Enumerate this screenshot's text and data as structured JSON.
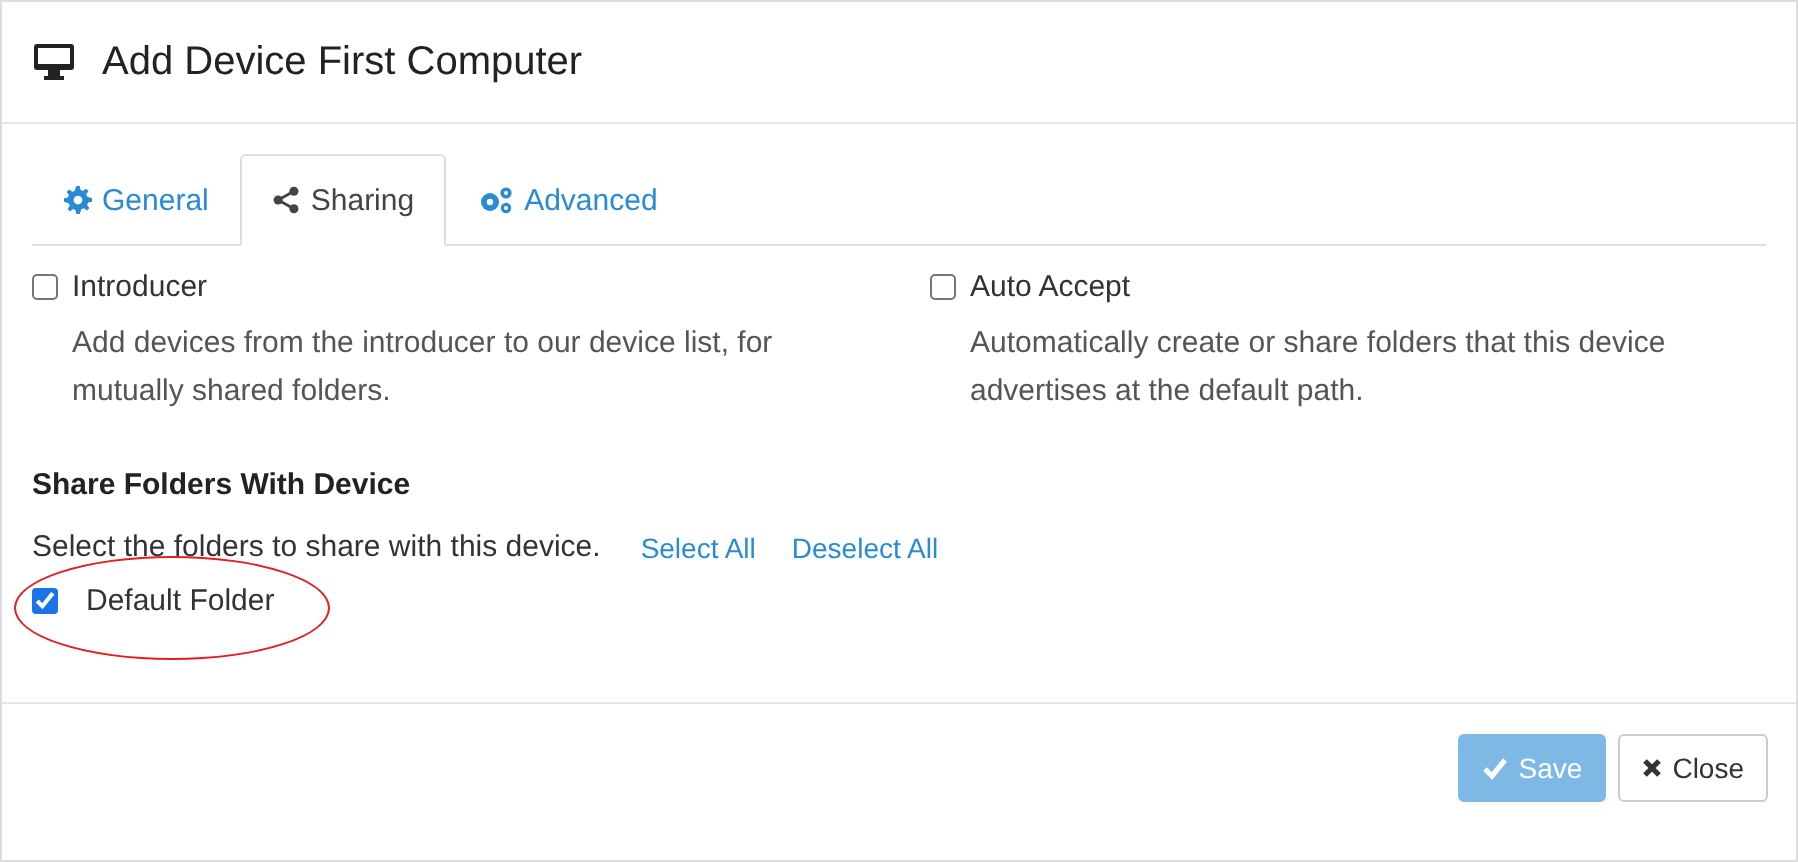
{
  "window": {
    "title": "Add Device First Computer"
  },
  "tabs": [
    {
      "label": "General",
      "selected": false
    },
    {
      "label": "Sharing",
      "selected": true
    },
    {
      "label": "Advanced",
      "selected": false
    }
  ],
  "options": [
    {
      "label": "Introducer",
      "checked": false,
      "help": "Add devices from the introducer to our device list, for mutually shared folders."
    },
    {
      "label": "Auto Accept",
      "checked": false,
      "help": "Automatically create or share folders that this device advertises at the default path."
    }
  ],
  "share": {
    "heading": "Share Folders With Device",
    "hint": "Select the folders to share with this device.",
    "links": [
      "Select All",
      "Deselect All"
    ],
    "folders": [
      {
        "label": "Default Folder",
        "checked": true,
        "circled": true
      }
    ]
  },
  "buttons": [
    {
      "label": "Save",
      "kind": "primary",
      "disabled": true
    },
    {
      "label": "Close",
      "kind": "default",
      "disabled": false
    }
  ]
}
